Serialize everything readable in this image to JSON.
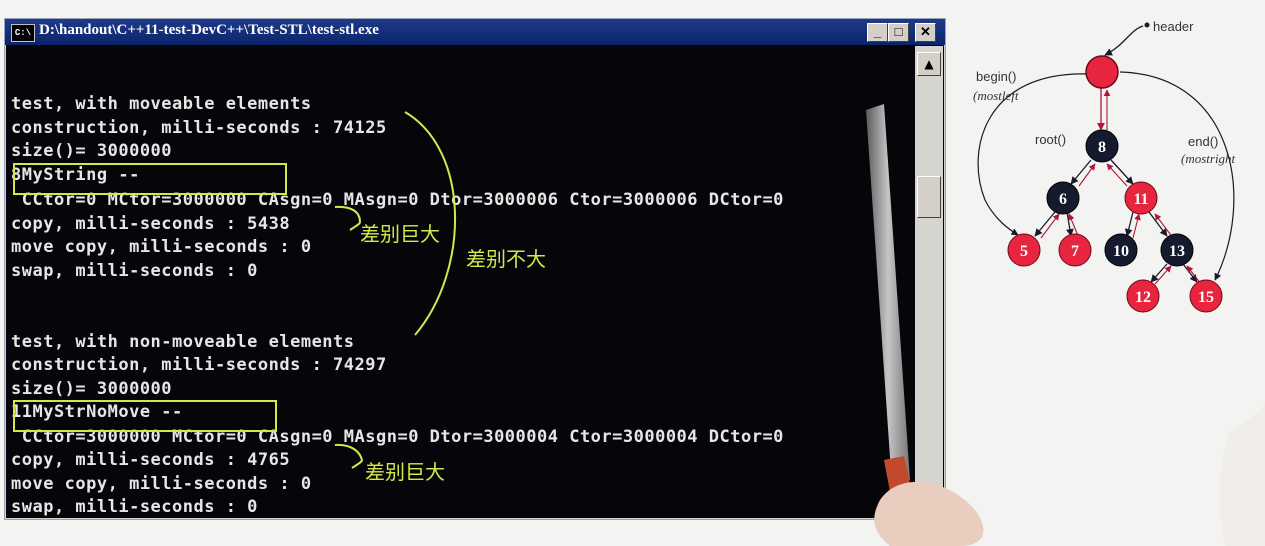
{
  "window": {
    "title": "D:\\handout\\C++11-test-DevC++\\Test-STL\\test-stl.exe",
    "icon_text": "C:\\",
    "buttons": {
      "minimize": "_",
      "maximize": "□",
      "close": "✕"
    },
    "scroll_up_glyph": "▲"
  },
  "console": {
    "lines": [
      "test, with moveable elements",
      "construction, milli-seconds : 74125",
      "size()= 3000000",
      "8MyString --",
      " CCtor=0 MCtor=3000000 CAsgn=0 MAsgn=0 Dtor=3000006 Ctor=3000006 DCtor=0",
      "copy, milli-seconds : 5438",
      "move copy, milli-seconds : 0",
      "swap, milli-seconds : 0",
      "",
      "",
      "test, with non-moveable elements",
      "construction, milli-seconds : 74297",
      "size()= 3000000",
      "11MyStrNoMove --",
      " CCtor=3000000 MCtor=0 CAsgn=0 MAsgn=0 Dtor=3000004 Ctor=3000004 DCtor=0",
      "copy, milli-seconds : 4765",
      "move copy, milli-seconds : 0",
      "swap, milli-seconds : 0"
    ]
  },
  "annotations": {
    "note_1": "差别巨大",
    "note_2": "差别不大",
    "note_3": "差别巨大",
    "highlight_color": "#d6e64a"
  },
  "tree": {
    "header_label": "header",
    "begin_label": "begin()",
    "begin_sub": "(mostleft",
    "root_label": "root()",
    "end_label": "end()",
    "end_sub": "(mostright",
    "nodes": [
      "8",
      "6",
      "11",
      "5",
      "7",
      "10",
      "13",
      "12",
      "15"
    ],
    "red_color": "#e8253f",
    "black_color": "#151a2e"
  }
}
